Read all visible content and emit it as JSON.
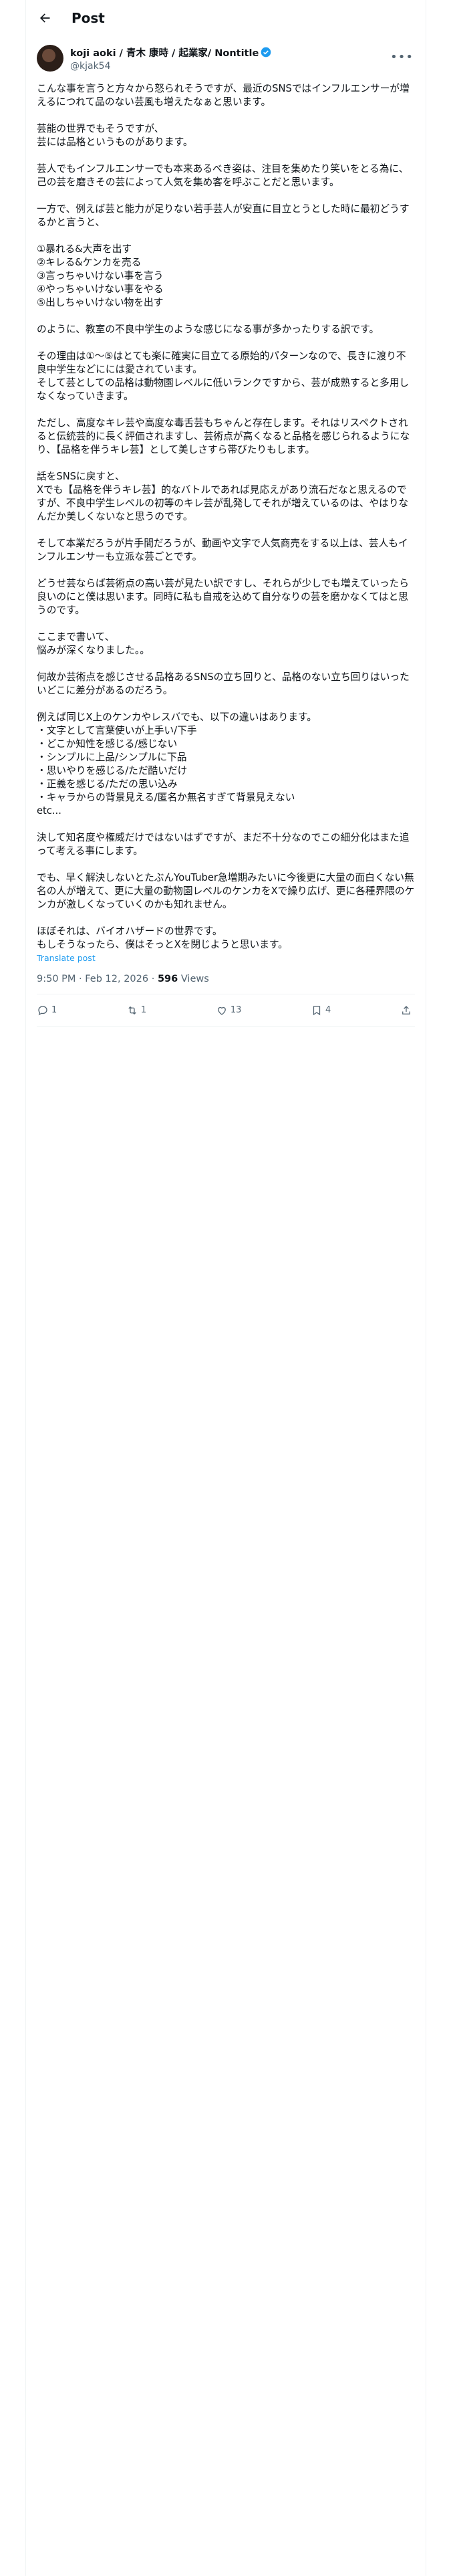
{
  "header": {
    "title": "Post",
    "back_icon": "arrow-left-icon"
  },
  "author": {
    "display_name": "koji aoki / 青木 康時 / 起業家/ Nontitle",
    "handle": "@kjak54",
    "verified": true,
    "more_icon": "more-horizontal-icon"
  },
  "post": {
    "paragraphs": [
      "こんな事を言うと方々から怒られそうですが、最近のSNSではインフルエンサーが増えるにつれて品のない芸風も増えたなぁと思います。",
      "芸能の世界でもそうですが、\n芸には品格というものがあります。",
      "芸人でもインフルエンサーでも本来あるべき姿は、注目を集めたり笑いをとる為に、己の芸を磨きその芸によって人気を集め客を呼ぶことだと思います。",
      "一方で、例えば芸と能力が足りない若手芸人が安直に目立とうとした時に最初どうするかと言うと、",
      "①暴れる&大声を出す\n②キレる&ケンカを売る\n③言っちゃいけない事を言う\n④やっちゃいけない事をやる\n⑤出しちゃいけない物を出す",
      "のように、教室の不良中学生のような感じになる事が多かったりする訳です。",
      "その理由は①〜⑤はとても楽に確実に目立てる原始的パターンなので、長きに渡り不良中学生などにには愛されています。\nそして芸としての品格は動物園レベルに低いランクですから、芸が成熟すると多用しなくなっていきます。",
      "ただし、高度なキレ芸や高度な毒舌芸もちゃんと存在します。それはリスペクトされると伝統芸的に長く評価されますし、芸術点が高くなると品格を感じられるようになり、【品格を伴うキレ芸】として美しさすら帯びたりもします。",
      "話をSNSに戻すと、\nXでも【品格を伴うキレ芸】的なバトルであれば見応えがあり流石だなと思えるのですが、不良中学生レベルの初等のキレ芸が乱発してそれが増えているのは、やはりなんだか美しくないなと思うのです。",
      "そして本業だろうが片手間だろうが、動画や文字で人気商売をする以上は、芸人もインフルエンサーも立派な芸ごとです。",
      "どうせ芸ならば芸術点の高い芸が見たい訳ですし、それらが少しでも増えていったら良いのにと僕は思います。同時に私も自戒を込めて自分なりの芸を磨かなくてはと思うのです。",
      "ここまで書いて、\n悩みが深くなりました。。",
      "何故か芸術点を感じさせる品格あるSNSの立ち回りと、品格のない立ち回りはいったいどこに差分があるのだろう。",
      "例えば同じX上のケンカやレスバでも、以下の違いはあります。\n・文字として言葉使いが上手い/下手\n・どこか知性を感じる/感じない\n・シンプルに上品/シンプルに下品\n・思いやりを感じる/ただ酷いだけ\n・正義を感じる/ただの思い込み\n・キャラからの背景見える/匿名か無名すぎて背景見えない\netc...",
      "決して知名度や権威だけではないはずですが、まだ不十分なのでこの細分化はまた追って考える事にします。",
      "でも、早く解決しないとたぶんYouTuber急増期みたいに今後更に大量の面白くない無名の人が増えて、更に大量の動物園レベルのケンカをXで繰り広げ、更に各種界隈のケンカが激しくなっていくのかも知れません。",
      "ほぼそれは、バイオハザードの世界です。\nもしそうなったら、僕はそっとXを閉じようと思います。"
    ],
    "translate_label": "Translate post",
    "timestamp": "9:50 PM · Feb 12, 2026 · ",
    "views_count": "596",
    "views_label": " Views"
  },
  "actions": {
    "reply": {
      "icon": "reply-icon",
      "count": "1"
    },
    "repost": {
      "icon": "repost-icon",
      "count": "1"
    },
    "like": {
      "icon": "heart-icon",
      "count": "13"
    },
    "bookmark": {
      "icon": "bookmark-icon",
      "count": "4"
    },
    "share": {
      "icon": "share-icon"
    }
  },
  "colors": {
    "accent": "#1d9bf0",
    "secondary_text": "#536471",
    "border": "#eff3f4"
  }
}
